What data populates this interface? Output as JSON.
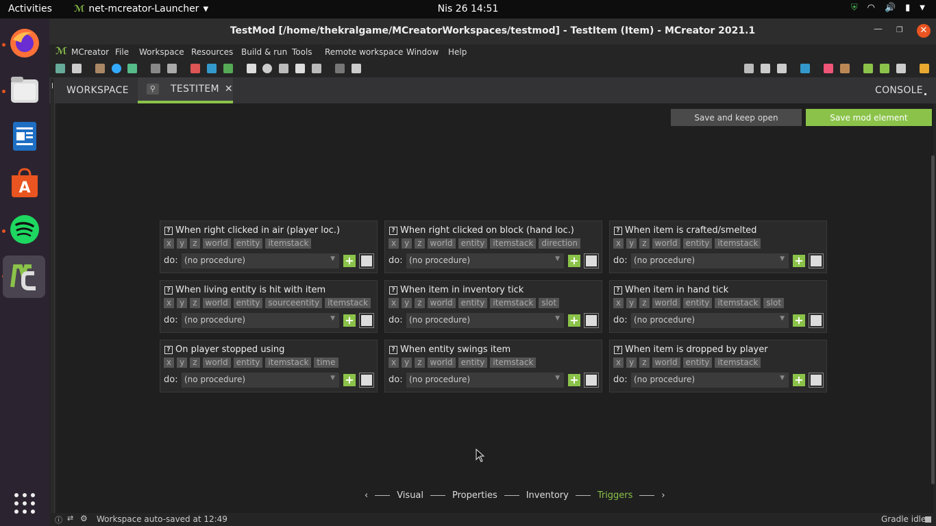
{
  "topbar": {
    "activities": "Activities",
    "app_name": "net-mcreator-Launcher",
    "clock": "Nis 26  14:51"
  },
  "window": {
    "title": "TestMod [/home/thekralgame/MCreatorWorkspaces/testmod] - TestItem (Item) - MCreator 2021.1"
  },
  "menu": [
    "MCreator",
    "File",
    "Workspace",
    "Resources",
    "Build & run",
    "Tools",
    "Remote workspace",
    "Window",
    "Help"
  ],
  "tabs": {
    "workspace": "WORKSPACE",
    "active": "TESTITEM",
    "console": "CONSOLE"
  },
  "actions": {
    "save_keep_open": "Save and keep open",
    "save_element": "Save mod element"
  },
  "triggers": [
    {
      "title": "When right clicked in air (player loc.)",
      "deps": [
        "x",
        "y",
        "z",
        "world",
        "entity",
        "itemstack"
      ],
      "do": "do:",
      "procedure": "(no procedure)"
    },
    {
      "title": "When right clicked on block (hand loc.)",
      "deps": [
        "x",
        "y",
        "z",
        "world",
        "entity",
        "itemstack",
        "direction"
      ],
      "do": "do:",
      "procedure": "(no procedure)"
    },
    {
      "title": "When item is crafted/smelted",
      "deps": [
        "x",
        "y",
        "z",
        "world",
        "entity",
        "itemstack"
      ],
      "do": "do:",
      "procedure": "(no procedure)"
    },
    {
      "title": "When living entity is hit with item",
      "deps": [
        "x",
        "y",
        "z",
        "world",
        "entity",
        "sourceentity",
        "itemstack"
      ],
      "do": "do:",
      "procedure": "(no procedure)"
    },
    {
      "title": "When item in inventory tick",
      "deps": [
        "x",
        "y",
        "z",
        "world",
        "entity",
        "itemstack",
        "slot"
      ],
      "do": "do:",
      "procedure": "(no procedure)"
    },
    {
      "title": "When item in hand tick",
      "deps": [
        "x",
        "y",
        "z",
        "world",
        "entity",
        "itemstack",
        "slot"
      ],
      "do": "do:",
      "procedure": "(no procedure)"
    },
    {
      "title": "On player stopped using",
      "deps": [
        "x",
        "y",
        "z",
        "world",
        "entity",
        "itemstack",
        "time"
      ],
      "do": "do:",
      "procedure": "(no procedure)"
    },
    {
      "title": "When entity swings item",
      "deps": [
        "x",
        "y",
        "z",
        "world",
        "entity",
        "itemstack"
      ],
      "do": "do:",
      "procedure": "(no procedure)"
    },
    {
      "title": "When item is dropped by player",
      "deps": [
        "x",
        "y",
        "z",
        "world",
        "entity",
        "itemstack"
      ],
      "do": "do:",
      "procedure": "(no procedure)"
    }
  ],
  "wizard": {
    "steps": [
      "Visual",
      "Properties",
      "Inventory",
      "Triggers"
    ],
    "active": "Triggers"
  },
  "status": {
    "message": "Workspace auto-saved at 12:49",
    "gradle": "Gradle idle"
  },
  "colors": {
    "accent_green": "#8bc34a",
    "ubuntu_orange": "#e95420"
  }
}
